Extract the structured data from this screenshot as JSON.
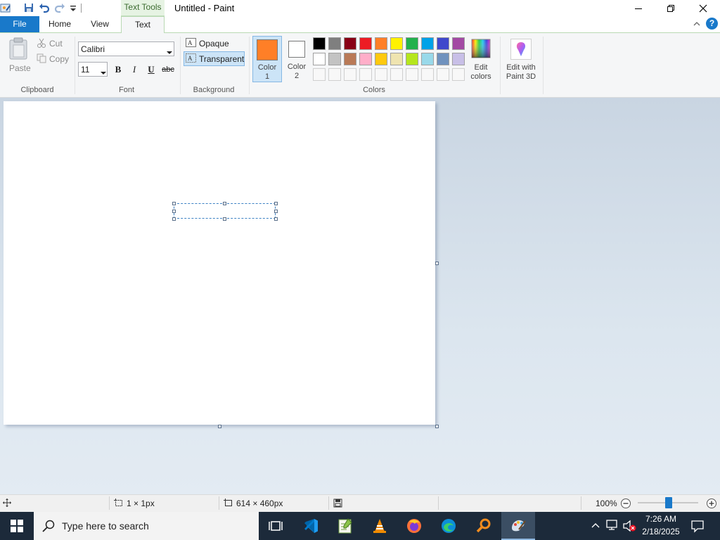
{
  "window": {
    "title": "Untitled - Paint",
    "contextual_tab": "Text Tools",
    "minimize": "—",
    "restore": "❐",
    "close": "✕"
  },
  "tabs": [
    {
      "label": "File"
    },
    {
      "label": "Home"
    },
    {
      "label": "View"
    },
    {
      "label": "Text"
    }
  ],
  "ribbon": {
    "clipboard": {
      "paste": "Paste",
      "cut": "Cut",
      "copy": "Copy",
      "group": "Clipboard"
    },
    "font": {
      "family": "Calibri",
      "size": "11",
      "bold": "B",
      "italic": "I",
      "underline": "U",
      "strike": "abc",
      "group": "Font"
    },
    "background": {
      "opaque": "Opaque",
      "transparent": "Transparent",
      "group": "Background"
    },
    "colors": {
      "color1_label": "Color\n1",
      "color1_a": "Color",
      "color1_b": "1",
      "color2_a": "Color",
      "color2_b": "2",
      "color1": "#ff7f27",
      "color2": "#ffffff",
      "edit_colors_a": "Edit",
      "edit_colors_b": "colors",
      "group": "Colors",
      "palette_row1": [
        "#000000",
        "#7f7f7f",
        "#880015",
        "#ed1c24",
        "#ff7f27",
        "#fff200",
        "#22b14c",
        "#00a2e8",
        "#3f48cc",
        "#a349a4"
      ],
      "palette_row2": [
        "#ffffff",
        "#c3c3c3",
        "#b97a57",
        "#ffaec9",
        "#ffc90e",
        "#efe4b0",
        "#b5e61d",
        "#99d9ea",
        "#7092be",
        "#c8bfe7"
      ]
    },
    "paint3d": {
      "line1": "Edit with",
      "line2": "Paint 3D"
    }
  },
  "canvas": {
    "background": "#ffffff"
  },
  "status": {
    "selection_size": "1 × 1px",
    "image_size": "614 × 460px",
    "zoom": "100%",
    "zoom_level": 100
  },
  "taskbar": {
    "search_placeholder": "Type here to search",
    "time": "7:26 AM",
    "date": "2/18/2025"
  }
}
